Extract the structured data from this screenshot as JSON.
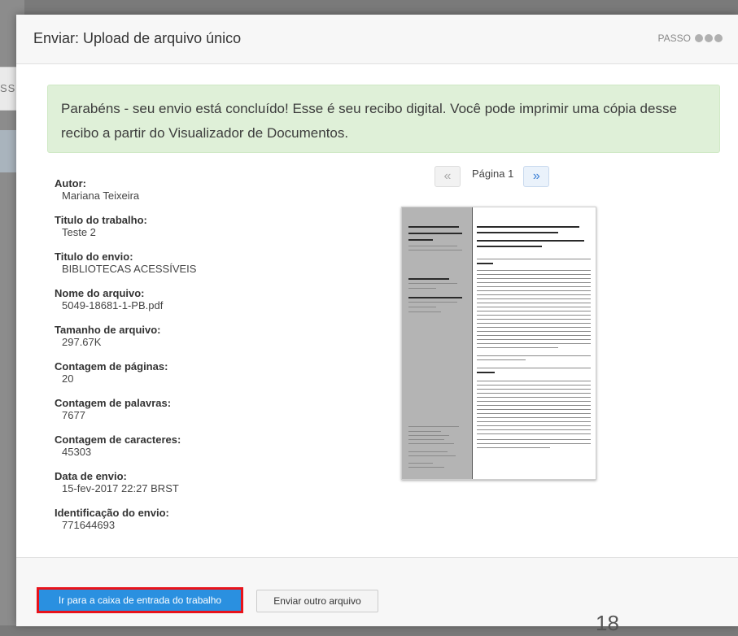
{
  "background": {
    "tab_fragment": "SSO",
    "bottom_number": "18"
  },
  "modal": {
    "title": "Enviar: Upload de arquivo único",
    "step_label": "PASSO"
  },
  "alert": {
    "message": "Parabéns - seu envio está concluído! Esse é seu recibo digital. Você pode imprimir uma cópia desse recibo a partir do Visualizador de Documentos."
  },
  "details": [
    {
      "label": "Autor:",
      "value": "Mariana Teixeira"
    },
    {
      "label": "Titulo do trabalho:",
      "value": "Teste 2"
    },
    {
      "label": "Titulo do envio:",
      "value": "BIBLIOTECAS ACESSÍVEIS"
    },
    {
      "label": "Nome do arquivo:",
      "value": "5049-18681-1-PB.pdf"
    },
    {
      "label": "Tamanho de arquivo:",
      "value": "297.67K"
    },
    {
      "label": "Contagem de páginas:",
      "value": "20"
    },
    {
      "label": "Contagem de palavras:",
      "value": "7677"
    },
    {
      "label": "Contagem de caracteres:",
      "value": "45303"
    },
    {
      "label": "Data de envio:",
      "value": "15-fev-2017 22:27 BRST"
    },
    {
      "label": "Identificação do envio:",
      "value": "771644693"
    }
  ],
  "viewer": {
    "prev_icon": "«",
    "page_label": "Página 1",
    "next_icon": "»"
  },
  "footer": {
    "primary_button": "Ir para a caixa de entrada do trabalho",
    "secondary_button": "Enviar outro arquivo"
  },
  "colors": {
    "alert_bg": "#dff0d8",
    "primary": "#2a90e0",
    "highlight_border": "#e8131b"
  }
}
